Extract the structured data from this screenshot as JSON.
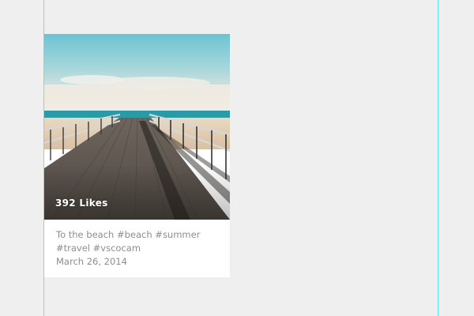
{
  "post": {
    "likes_label": "392 Likes",
    "caption": "To the beach #beach #summer #travel #vscocam",
    "date": "March 26, 2014"
  },
  "colors": {
    "background": "#efefef",
    "guide": "#5fe3ee",
    "card": "#ffffff",
    "caption_text": "#8d8d8d"
  }
}
